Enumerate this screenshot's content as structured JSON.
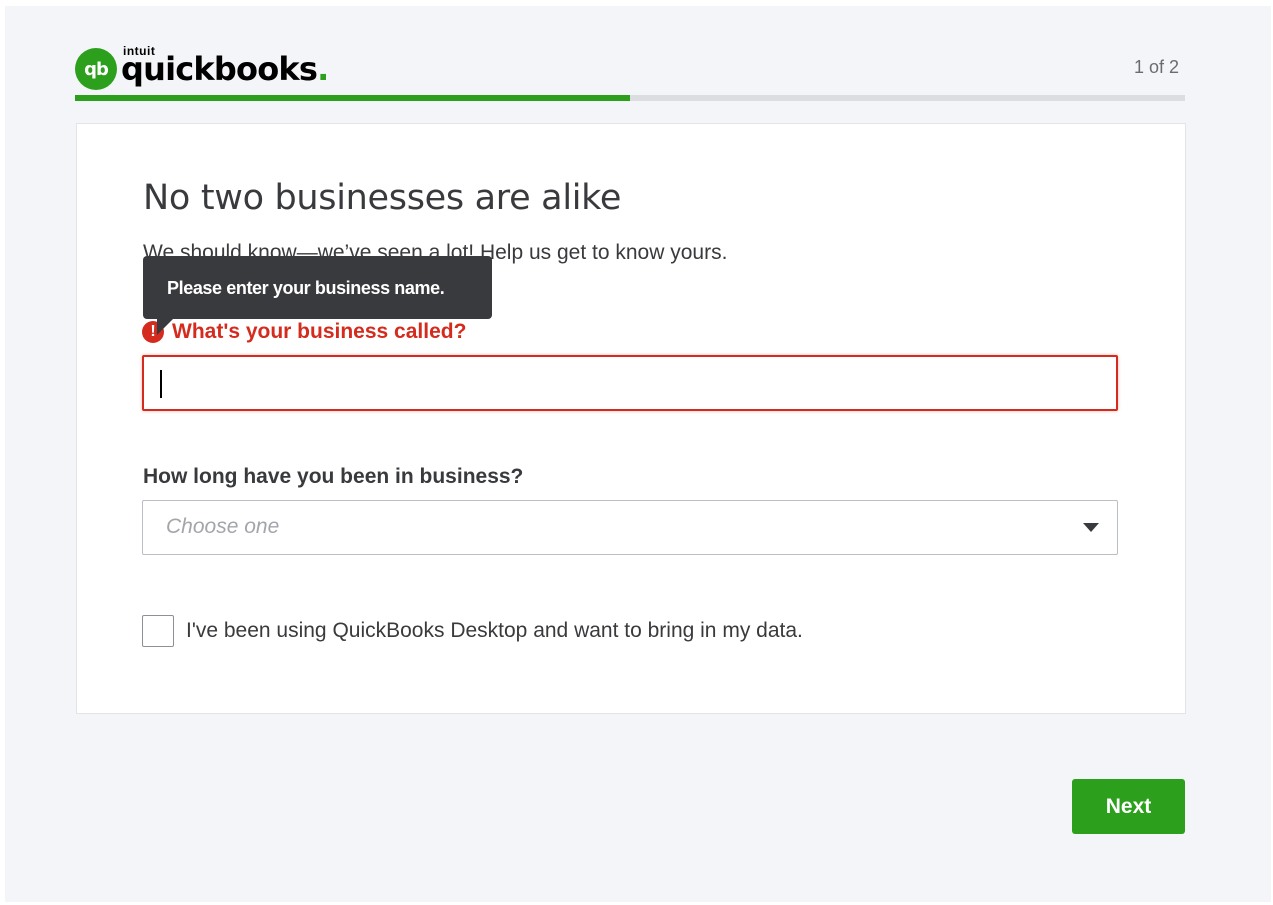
{
  "brand": {
    "intuit": "intuit",
    "name": "quickbooks",
    "mark": "qb",
    "accent_color": "#2ca01c"
  },
  "progress": {
    "step_label": "1 of 2",
    "fraction": 0.5
  },
  "form": {
    "title": "No two businesses are alike",
    "subtitle": "We should know—we’ve seen a lot! Help us get to know yours.",
    "tooltip": "Please enter your business name.",
    "business_name": {
      "label": "What's your business called?",
      "value": "",
      "error_icon": "!",
      "error_color": "#d52b1e"
    },
    "duration": {
      "label": "How long have you been in business?",
      "placeholder": "Choose one"
    },
    "import_checkbox": {
      "label": "I've been using QuickBooks Desktop and want to bring in my data.",
      "checked": false
    }
  },
  "actions": {
    "next_label": "Next"
  },
  "icons": {
    "error": "error-icon",
    "dropdown": "chevron-down-icon"
  }
}
